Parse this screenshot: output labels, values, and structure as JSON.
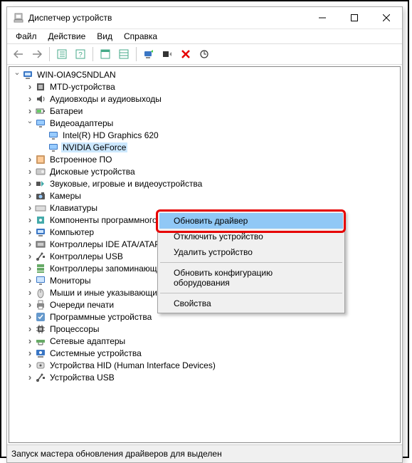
{
  "title": "Диспетчер устройств",
  "menu": {
    "file": "Файл",
    "action": "Действие",
    "view": "Вид",
    "help": "Справка"
  },
  "tree": {
    "root": "WIN-OIA9C5NDLAN",
    "items": [
      {
        "label": "MTD-устройства",
        "icon": "chip"
      },
      {
        "label": "Аудиовходы и аудиовыходы",
        "icon": "speaker"
      },
      {
        "label": "Батареи",
        "icon": "battery"
      },
      {
        "label": "Видеоадаптеры",
        "icon": "display",
        "expanded": true,
        "children": [
          {
            "label": "Intel(R) HD Graphics 620",
            "icon": "display"
          },
          {
            "label": "NVIDIA GeForce",
            "icon": "display",
            "selected": true
          }
        ]
      },
      {
        "label": "Встроенное ПО",
        "icon": "firmware"
      },
      {
        "label": "Дисковые устройства",
        "icon": "disk"
      },
      {
        "label": "Звуковые, игровые и видеоустройства",
        "icon": "sound"
      },
      {
        "label": "Камеры",
        "icon": "camera"
      },
      {
        "label": "Клавиатуры",
        "icon": "keyboard"
      },
      {
        "label": "Компоненты программного обеспечения",
        "icon": "component"
      },
      {
        "label": "Компьютер",
        "icon": "computer"
      },
      {
        "label": "Контроллеры IDE ATA/ATAPI",
        "icon": "ide"
      },
      {
        "label": "Контроллеры USB",
        "icon": "usb"
      },
      {
        "label": "Контроллеры запоминающих устройств",
        "icon": "storage"
      },
      {
        "label": "Мониторы",
        "icon": "monitor"
      },
      {
        "label": "Мыши и иные указывающие устройства",
        "icon": "mouse"
      },
      {
        "label": "Очереди печати",
        "icon": "printer"
      },
      {
        "label": "Программные устройства",
        "icon": "software"
      },
      {
        "label": "Процессоры",
        "icon": "cpu"
      },
      {
        "label": "Сетевые адаптеры",
        "icon": "network"
      },
      {
        "label": "Системные устройства",
        "icon": "system"
      },
      {
        "label": "Устройства HID (Human Interface Devices)",
        "icon": "hid"
      },
      {
        "label": "Устройства USB",
        "icon": "usb"
      }
    ]
  },
  "context_menu": {
    "update_driver": "Обновить драйвер",
    "disable_device": "Отключить устройство",
    "remove_device": "Удалить устройство",
    "refresh_config": "Обновить конфигурацию оборудования",
    "properties": "Свойства"
  },
  "status": "Запуск мастера обновления драйверов для выделен",
  "icons": {
    "computer_svg": "computer",
    "colors": {
      "blue": "#3a76c4",
      "teal": "#4aa",
      "red": "#e60000",
      "gray": "#888"
    }
  }
}
